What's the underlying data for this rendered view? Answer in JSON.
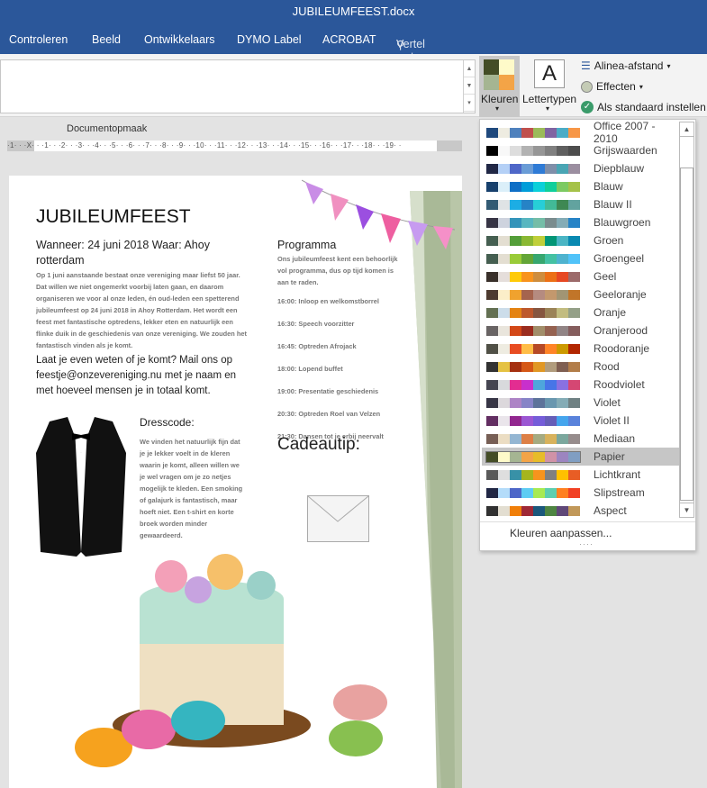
{
  "window": {
    "title": "JUBILEUMFEEST.docx"
  },
  "tabs": [
    "Controleren",
    "Beeld",
    "Ontwikkelaars",
    "DYMO Label",
    "ACROBAT"
  ],
  "tell_me": "Vertel wat u wilt doen",
  "ribbon": {
    "kleuren": "Kleuren",
    "lettertypen": "Lettertypen",
    "lettertypen_glyph": "A",
    "alinea": "Alinea-afstand",
    "effecten": "Effecten",
    "standaard": "Als standaard instellen",
    "group": "Documentopmaak",
    "current_palette": [
      "#444d26",
      "#fefac9",
      "#a5b592",
      "#f3a447"
    ]
  },
  "ruler": "·1· · ·X· · ·1· · ·2· · ·3· · ·4· · ·5· · ·6· · ·7· · ·8· · ·9· · ·10· · ·11· · ·12· · ·13· · ·14· · ·15· · ·16· · ·17· · ·18· · ·19· ·",
  "document": {
    "title": "JUBILEUMFEEST",
    "when": "Wanneer: 24 juni 2018 Waar: Ahoy rotterdam",
    "intro": "Op 1 juni aanstaande bestaat onze vereniging maar liefst 50 jaar. Dat willen we niet ongemerkt voorbij laten gaan, en daarom organiseren we voor al onze leden, én oud-leden een spetterend jubileumfeest op 24 juni 2018 in Ahoy Rotterdam. Het wordt een feest met fantastische optredens, lekker eten en natuurlijk een flinke duik in de geschiedenis van onze vereniging. We zouden het fantastisch vinden als je komt.",
    "rsvp": "Laat je even weten of je komt? Mail ons op feestje@onzevereniging.nu met je naam en met hoeveel mensen je in totaal komt.",
    "programma_title": "Programma",
    "programma_intro": "Ons jubileumfeest kent een behoorlijk vol programma,  dus op tijd komen is aan te raden.",
    "programma": [
      "16:00: Inloop en welkomstborrel",
      "16:30: Speech voorzitter",
      "16:45: Optreden Afrojack",
      "18:00: Lopend buffet",
      "19:00: Presentatie geschiedenis",
      "20:30: Optreden Roel van Velzen",
      "21:30: Dansen tot je erbij neervalt"
    ],
    "dresscode_title": "Dresscode:",
    "dresscode": "We vinden het natuurlijk fijn dat je je lekker voelt in de kleren waarin je komt, alleen willen we je wel vragen om je zo netjes mogelijk te kleden. Een smoking of galajurk is fantastisch, maar hoeft niet. Een t-shirt en korte broek worden minder gewaardeerd.",
    "cadeautip": "Cadeautip:"
  },
  "dropdown": {
    "selected": "Papier",
    "custom": "Kleuren aanpassen...",
    "themes": [
      {
        "name": "Office 2007 - 2010",
        "colors": [
          "#1f497d",
          "#eeece1",
          "#4f81bd",
          "#c0504d",
          "#9bbb59",
          "#8064a2",
          "#4bacc6",
          "#f79646"
        ]
      },
      {
        "name": "Grijswaarden",
        "colors": [
          "#000000",
          "#f8f8f8",
          "#dddddd",
          "#b2b2b2",
          "#969696",
          "#808080",
          "#5f5f5f",
          "#4d4d4d"
        ]
      },
      {
        "name": "Diepblauw",
        "colors": [
          "#212745",
          "#b4d0f6",
          "#4e67c8",
          "#6a9cd6",
          "#2f7bd6",
          "#7f8fa9",
          "#4aa5b4",
          "#9b8ea0"
        ]
      },
      {
        "name": "Blauw",
        "colors": [
          "#17406d",
          "#dbeff9",
          "#0f6fc6",
          "#009dd9",
          "#0bd0d9",
          "#10cf9b",
          "#7cca62",
          "#a5c249"
        ]
      },
      {
        "name": "Blauw II",
        "colors": [
          "#335b74",
          "#dfe3e5",
          "#1cade4",
          "#2683c6",
          "#27ced7",
          "#42ba97",
          "#3e8853",
          "#62a39f"
        ]
      },
      {
        "name": "Blauwgroen",
        "colors": [
          "#373545",
          "#ced3de",
          "#3494ba",
          "#58b6c0",
          "#75bda7",
          "#7a8c8e",
          "#84acb6",
          "#2683c6"
        ]
      },
      {
        "name": "Groen",
        "colors": [
          "#455f51",
          "#e3ded1",
          "#549e39",
          "#8ab833",
          "#c0cf3a",
          "#029676",
          "#4ab5c4",
          "#0989b1"
        ]
      },
      {
        "name": "Groengeel",
        "colors": [
          "#455f51",
          "#e3ded1",
          "#99cb38",
          "#63a537",
          "#37a76f",
          "#44c1a3",
          "#4eb3cf",
          "#51c3f9"
        ]
      },
      {
        "name": "Geel",
        "colors": [
          "#39302a",
          "#e5dedb",
          "#ffca08",
          "#f8931d",
          "#ce8d3e",
          "#ec7016",
          "#e64823",
          "#9c6a6a"
        ]
      },
      {
        "name": "Geeloranje",
        "colors": [
          "#4e3b30",
          "#fbeec9",
          "#f0a22e",
          "#a5644e",
          "#b58b80",
          "#c3986d",
          "#a19574",
          "#c17529"
        ]
      },
      {
        "name": "Oranje",
        "colors": [
          "#637052",
          "#ccddea",
          "#e48312",
          "#bd582c",
          "#865640",
          "#9b8357",
          "#c2bc80",
          "#94a088"
        ]
      },
      {
        "name": "Oranjerood",
        "colors": [
          "#696464",
          "#e9e5dc",
          "#d34817",
          "#9b2d1f",
          "#a28e6a",
          "#956251",
          "#918485",
          "#855d5d"
        ]
      },
      {
        "name": "Roodoranje",
        "colors": [
          "#505046",
          "#eeece1",
          "#e84c22",
          "#ffbd47",
          "#b64926",
          "#ff8427",
          "#cc9900",
          "#b22600"
        ]
      },
      {
        "name": "Rood",
        "colors": [
          "#323232",
          "#e5c243",
          "#a5300f",
          "#d55816",
          "#e19825",
          "#b19c7d",
          "#7f5f52",
          "#b27d49"
        ]
      },
      {
        "name": "Roodviolet",
        "colors": [
          "#454551",
          "#d8d9dc",
          "#e32d91",
          "#c830cc",
          "#4ea6dc",
          "#4775e7",
          "#8971e1",
          "#d54773"
        ]
      },
      {
        "name": "Violet",
        "colors": [
          "#373545",
          "#dcd8dc",
          "#ad84c6",
          "#8784c7",
          "#5d739a",
          "#6997af",
          "#84acb6",
          "#6f8183"
        ]
      },
      {
        "name": "Violet II",
        "colors": [
          "#632e62",
          "#eae5eb",
          "#92278f",
          "#9b57d3",
          "#755dd9",
          "#665eb8",
          "#45a5ed",
          "#5982db"
        ]
      },
      {
        "name": "Mediaan",
        "colors": [
          "#775f55",
          "#ebddc3",
          "#94b6d2",
          "#dd8047",
          "#a5ab81",
          "#d8b25c",
          "#7ba79d",
          "#968c8c"
        ]
      },
      {
        "name": "Papier",
        "colors": [
          "#444d26",
          "#fefac9",
          "#a5b592",
          "#f3a447",
          "#e7bc29",
          "#d092a7",
          "#9c85c0",
          "#809ec2"
        ]
      },
      {
        "name": "Lichtkrant",
        "colors": [
          "#5a5a5a",
          "#dedede",
          "#3891a7",
          "#a5b51e",
          "#f7941d",
          "#808080",
          "#ffc000",
          "#e85d25"
        ]
      },
      {
        "name": "Slipstream",
        "colors": [
          "#212745",
          "#b4dcfa",
          "#4e67c8",
          "#5eccf3",
          "#a7ea52",
          "#5dceaf",
          "#ff8021",
          "#f14124"
        ]
      },
      {
        "name": "Aspect",
        "colors": [
          "#323232",
          "#e3ded1",
          "#f07f09",
          "#9f2936",
          "#1b587c",
          "#4e8542",
          "#604878",
          "#c19859"
        ]
      }
    ]
  }
}
